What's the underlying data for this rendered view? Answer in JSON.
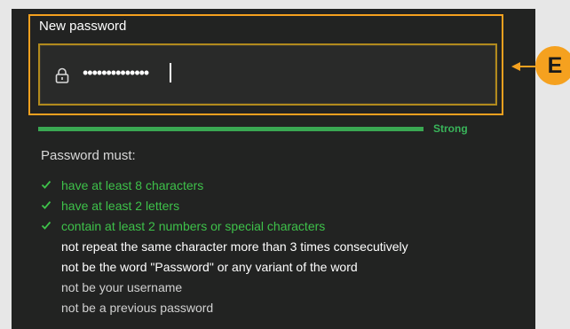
{
  "field": {
    "label": "New password",
    "value": "••••••••••••••",
    "icon": "lock-icon"
  },
  "callout": {
    "letter": "E",
    "color": "#f5a11f"
  },
  "strength": {
    "label": "Strong",
    "color": "#39b55a"
  },
  "requirements": {
    "title": "Password must:",
    "items": [
      {
        "text": "have at least 8 characters",
        "state": "met"
      },
      {
        "text": "have at least 2 letters",
        "state": "met"
      },
      {
        "text": "contain at least 2 numbers or special characters",
        "state": "met"
      },
      {
        "text": "not repeat the same character more than 3 times consecutively",
        "state": "pending"
      },
      {
        "text": "not be the word \"Password\" or any variant of the word",
        "state": "pending"
      },
      {
        "text": "not be your username",
        "state": "muted"
      },
      {
        "text": "not be a previous password",
        "state": "muted"
      }
    ]
  },
  "colors": {
    "background": "#222322",
    "accent": "#f5a11f",
    "success": "#3ec14a"
  }
}
